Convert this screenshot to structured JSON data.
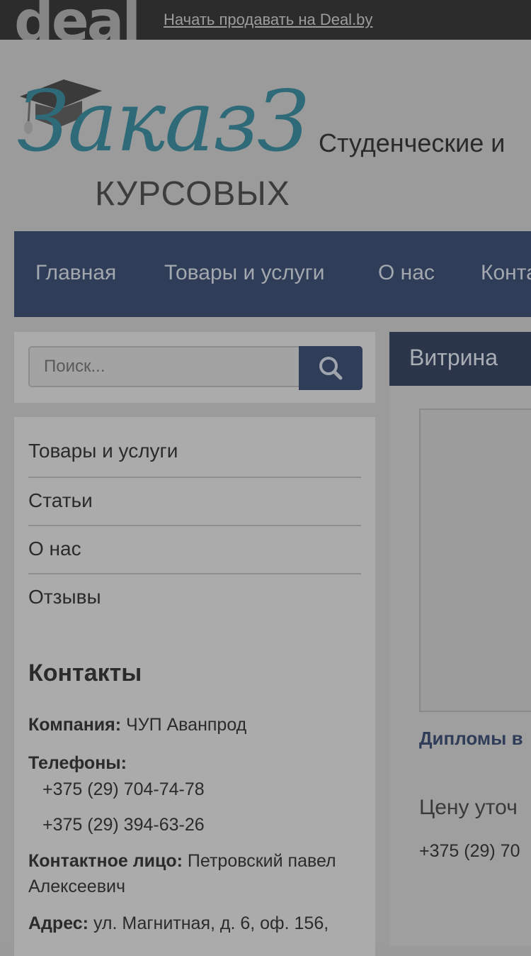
{
  "topbar": {
    "logo": "deal",
    "sell_link": "Начать продавать на Deal.by"
  },
  "header": {
    "logo_script": "ЗаказЗ",
    "logo_sub": "КУРСОВЫХ",
    "tagline": "Студенческие и"
  },
  "nav": {
    "items": [
      "Главная",
      "Товары и услуги",
      "О нас",
      "Конта"
    ]
  },
  "search": {
    "placeholder": "Поиск..."
  },
  "sidebar": {
    "links": [
      "Товары и услуги",
      "Статьи",
      "О нас",
      "Отзывы"
    ]
  },
  "contacts": {
    "title": "Контакты",
    "company_label": "Компания:",
    "company_value": "ЧУП Аванпрод",
    "phones_label": "Телефоны:",
    "phones": [
      "+375 (29) 704-74-78",
      "+375 (29) 394-63-26"
    ],
    "person_label": "Контактное лицо:",
    "person_value_1": "Петровский павел",
    "person_value_2": "Алексеевич",
    "address_label": "Адрес:",
    "address_value": "ул. Магнитная, д. 6, оф. 156,"
  },
  "showcase": {
    "title": "Витрина",
    "product_name": "Дипломы в",
    "price_note": "Цену уточ",
    "phone": "+375 (29) 70"
  }
}
